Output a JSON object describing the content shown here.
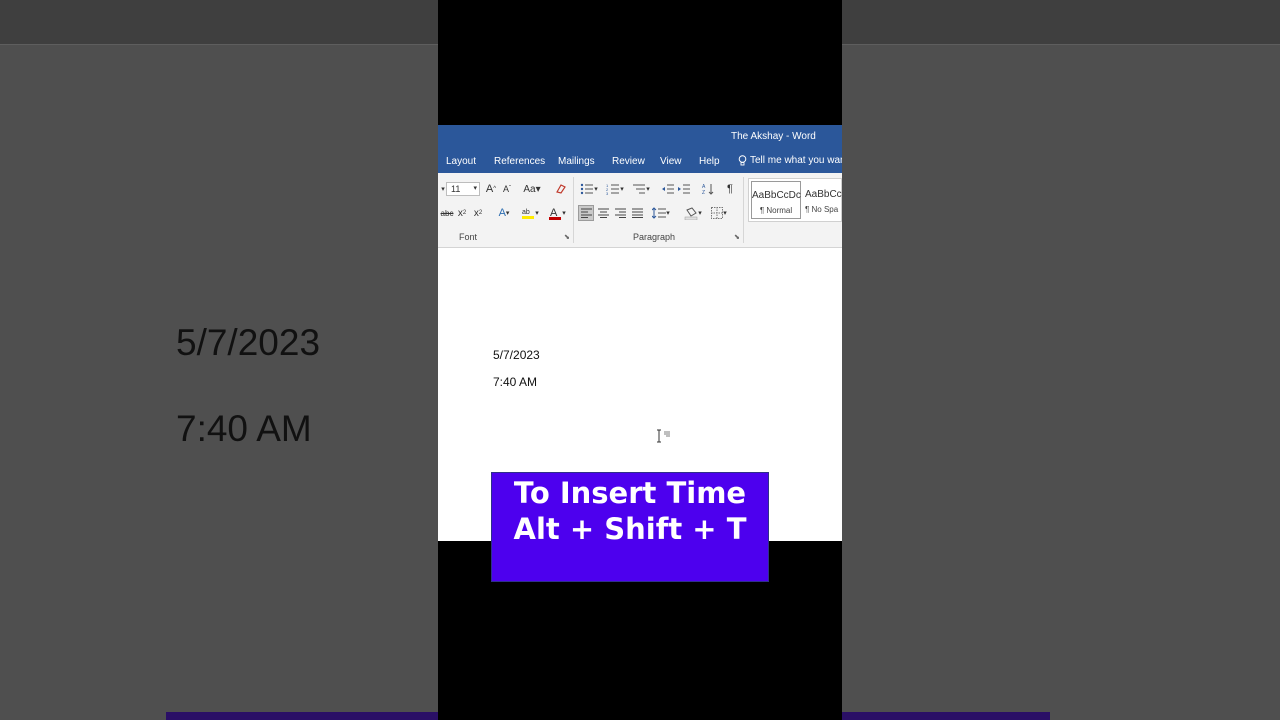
{
  "background": {
    "date": "5/7/2023",
    "time": "7:40 AM"
  },
  "window": {
    "title": "The Akshay  -  Word"
  },
  "tabs": [
    "Layout",
    "References",
    "Mailings",
    "Review",
    "View",
    "Help"
  ],
  "tell_me": "Tell me what you want",
  "ribbon": {
    "font_size": "11",
    "groups": {
      "font": "Font",
      "paragraph": "Paragraph"
    },
    "styles": [
      {
        "sample": "AaBbCcDc",
        "name": "¶ Normal"
      },
      {
        "sample": "AaBbCc",
        "name": "¶ No Spa"
      }
    ]
  },
  "document": {
    "line1": "5/7/2023",
    "line2": "7:40 AM"
  },
  "caption": {
    "line1": "To Insert Time",
    "line2": "Alt + Shift + T"
  },
  "colors": {
    "word_blue": "#2b579a",
    "caption_bg": "#4d00ee"
  }
}
